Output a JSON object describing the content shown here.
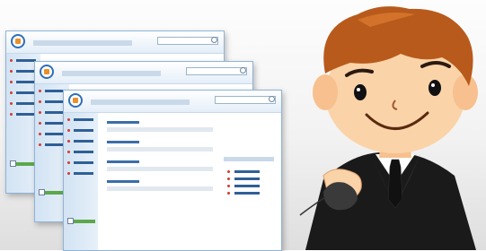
{
  "scene": {
    "windows": [
      {
        "id": "back"
      },
      {
        "id": "middle"
      },
      {
        "id": "front"
      }
    ]
  },
  "colors": {
    "window_border": "#8fb3d6",
    "sidebar": "#d2e3f3",
    "link_blue": "#2f5f97",
    "bullet_red": "#d23a2f",
    "button_green": "#5da84a",
    "hair": "#b85a1c",
    "skin": "#fbd3a8",
    "suit": "#1a1a1a",
    "mouse": "#3a3a3a"
  },
  "icons": [
    "home-logo-icon",
    "search-icon",
    "bullet-icon",
    "checkbox-icon",
    "computer-mouse-icon"
  ]
}
